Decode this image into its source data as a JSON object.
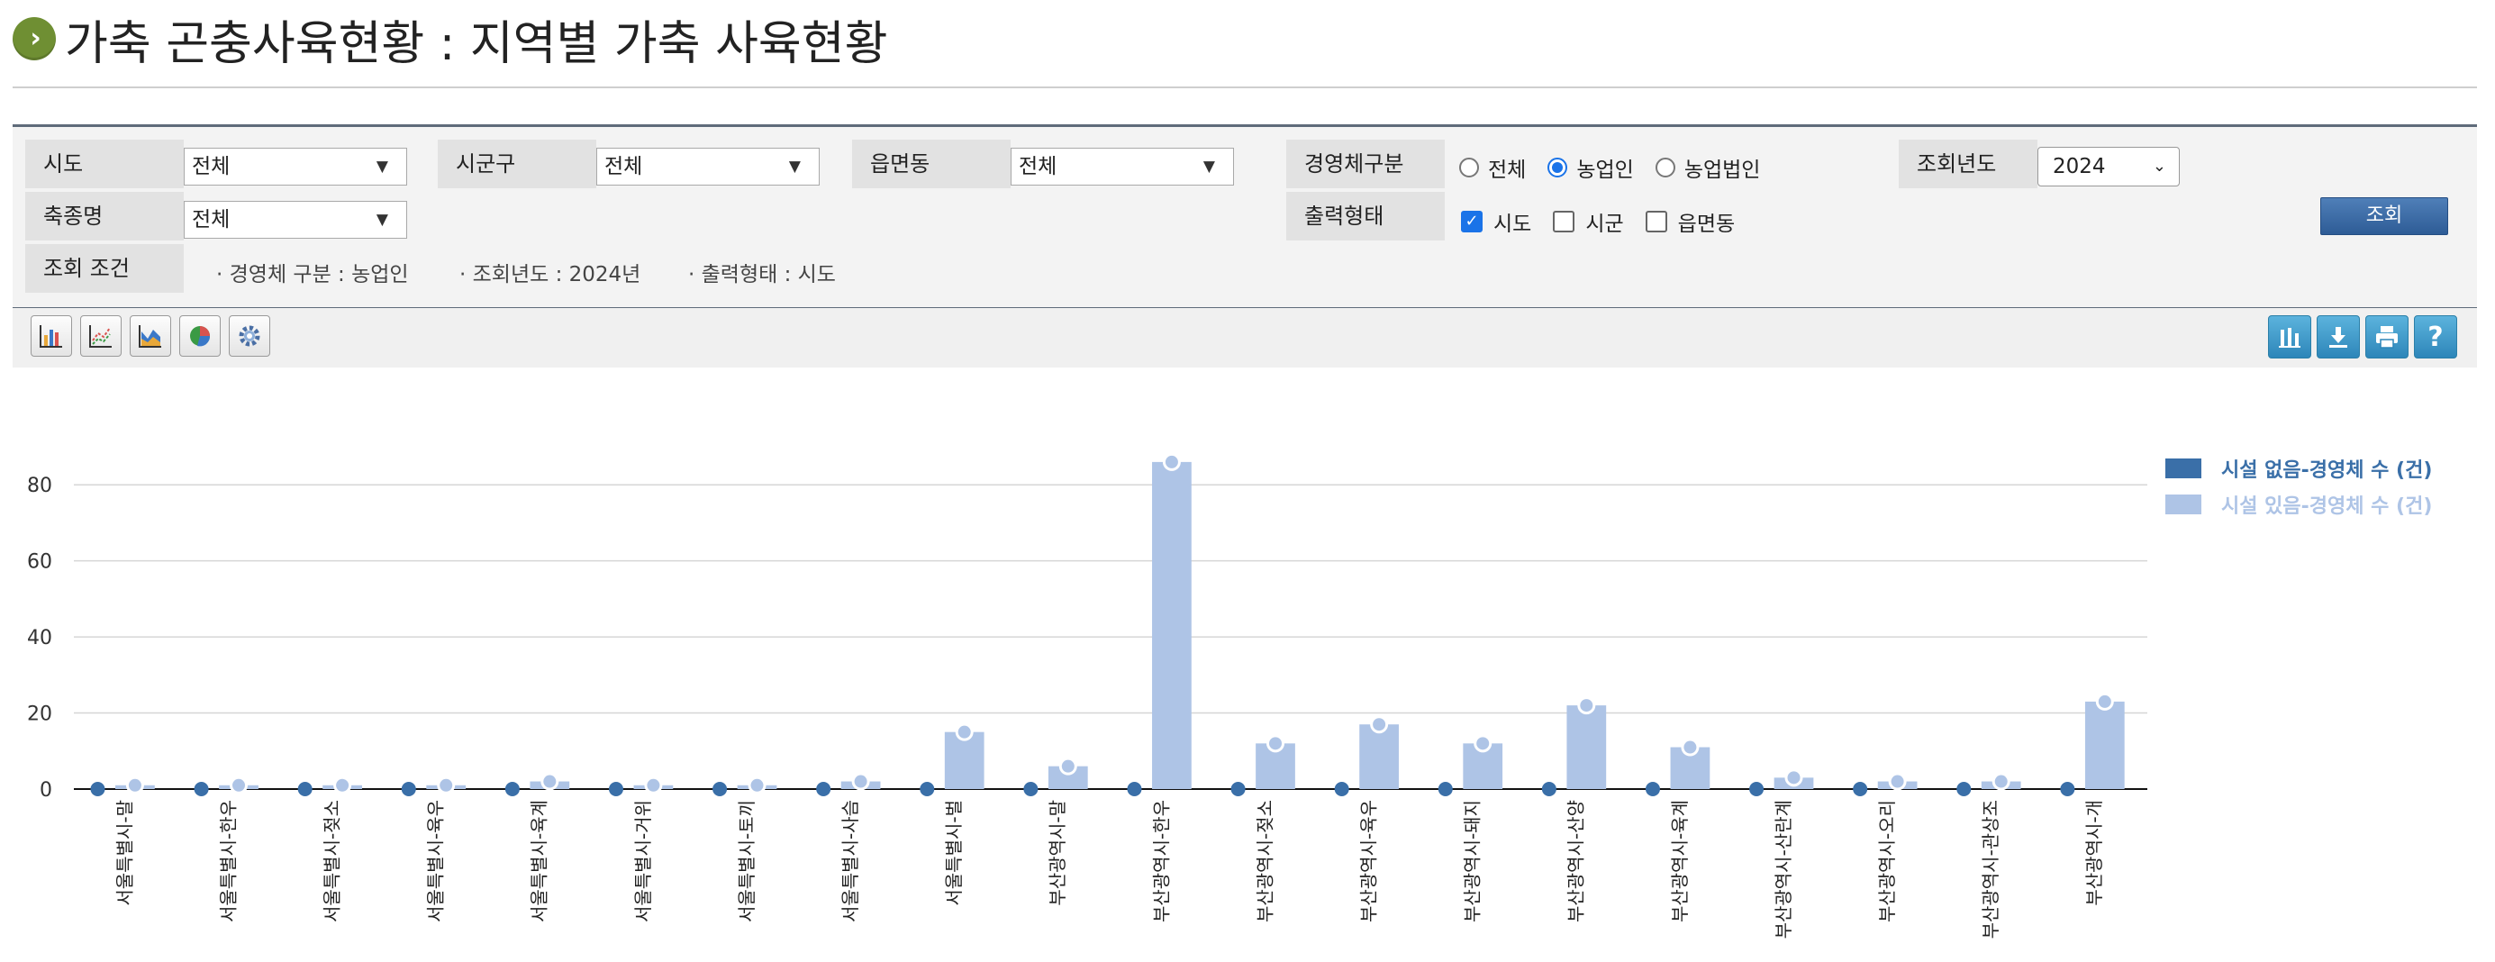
{
  "header": {
    "title": "가축 곤충사육현황 : 지역별 가축 사육현황"
  },
  "search": {
    "sido_label": "시도",
    "sido_value": "전체",
    "sigungu_label": "시군구",
    "sigungu_value": "전체",
    "eupmyeondong_label": "읍면동",
    "eupmyeondong_value": "전체",
    "livestock_label": "축종명",
    "livestock_value": "전체",
    "entity_type_label": "경영체구분",
    "entity_type_options": [
      "전체",
      "농업인",
      "농업법인"
    ],
    "entity_type_selected": "농업인",
    "year_label": "조회년도",
    "year_value": "2024",
    "output_label": "출력형태",
    "output_options": [
      "시도",
      "시군",
      "읍면동"
    ],
    "output_checked": [
      true,
      false,
      false
    ],
    "query_button": "조회",
    "condition_label": "조회 조건",
    "conditions": [
      "· 경영체 구분 : 농업인",
      "· 조회년도 : 2024년",
      "· 출력형태 : 시도"
    ]
  },
  "toolbar": {
    "left_icons": [
      "bar-chart-icon",
      "line-chart-icon",
      "area-chart-icon",
      "pie-chart-icon",
      "settings-gear-icon"
    ],
    "right_icons": [
      "column-view-icon",
      "download-icon",
      "print-icon",
      "help-icon"
    ]
  },
  "colors": {
    "series1": "#3a6fa8",
    "series2": "#aec4e6",
    "accent": "#2e5c96"
  },
  "chart_data": {
    "type": "bar",
    "categories": [
      "서울특별시-말",
      "서울특별시-한우",
      "서울특별시-젖소",
      "서울특별시-육우",
      "서울특별시-육계",
      "서울특별시-거위",
      "서울특별시-토끼",
      "서울특별시-사슴",
      "서울특별시-벌",
      "부산광역시-말",
      "부산광역시-한우",
      "부산광역시-젖소",
      "부산광역시-육우",
      "부산광역시-돼지",
      "부산광역시-산양",
      "부산광역시-육계",
      "부산광역시-산란계",
      "부산광역시-오리",
      "부산광역시-관상조",
      "부산광역시-개"
    ],
    "series": [
      {
        "name": "시설 없음-경영체 수 (건)",
        "values": [
          0,
          0,
          0,
          0,
          0,
          0,
          0,
          0,
          0,
          0,
          0,
          0,
          0,
          0,
          0,
          0,
          0,
          0,
          0,
          0
        ]
      },
      {
        "name": "시설 있음-경영체 수 (건)",
        "values": [
          1,
          1,
          1,
          1,
          2,
          1,
          1,
          2,
          15,
          6,
          86,
          12,
          17,
          12,
          22,
          11,
          3,
          2,
          2,
          23
        ]
      }
    ],
    "ylim": [
      0,
      90
    ],
    "yticks": [
      0,
      20,
      40,
      60,
      80
    ],
    "grid": true,
    "legend": "top-right"
  }
}
